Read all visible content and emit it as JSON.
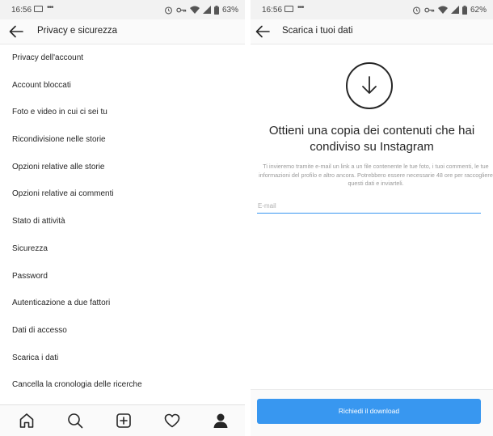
{
  "left_screen": {
    "status": {
      "time": "16:56",
      "battery": "63%"
    },
    "title": "Privacy e sicurezza",
    "menu_items": [
      "Privacy dell'account",
      "Account bloccati",
      "Foto e video in cui ci sei tu",
      "Ricondivisione nelle storie",
      "Opzioni relative alle storie",
      "Opzioni relative ai commenti",
      "Stato di attività",
      "Sicurezza",
      "Password",
      "Autenticazione a due fattori",
      "Dati di accesso",
      "Scarica i dati",
      "Cancella la cronologia delle ricerche"
    ],
    "bottom_nav": [
      "home-icon",
      "search-icon",
      "add-post-icon",
      "heart-icon",
      "profile-icon"
    ]
  },
  "right_screen": {
    "status": {
      "time": "16:56",
      "battery": "62%"
    },
    "title": "Scarica i tuoi dati",
    "headline": "Ottieni una copia dei contenuti che hai condiviso su Instagram",
    "description": "Ti invieremo tramite e-mail un link a un file contenente le tue foto, i tuoi commenti, le tue informazioni del profilo e altro ancora. Potrebbero essere necessarie 48 ore per raccogliere questi dati e inviarteli.",
    "email_placeholder": "E-mail",
    "email_value": "",
    "button_label": "Richiedi il download"
  },
  "colors": {
    "accent": "#3897f0",
    "text": "#262626",
    "muted": "#9a9a9a",
    "statusbar_bg": "#f2f2f2"
  }
}
